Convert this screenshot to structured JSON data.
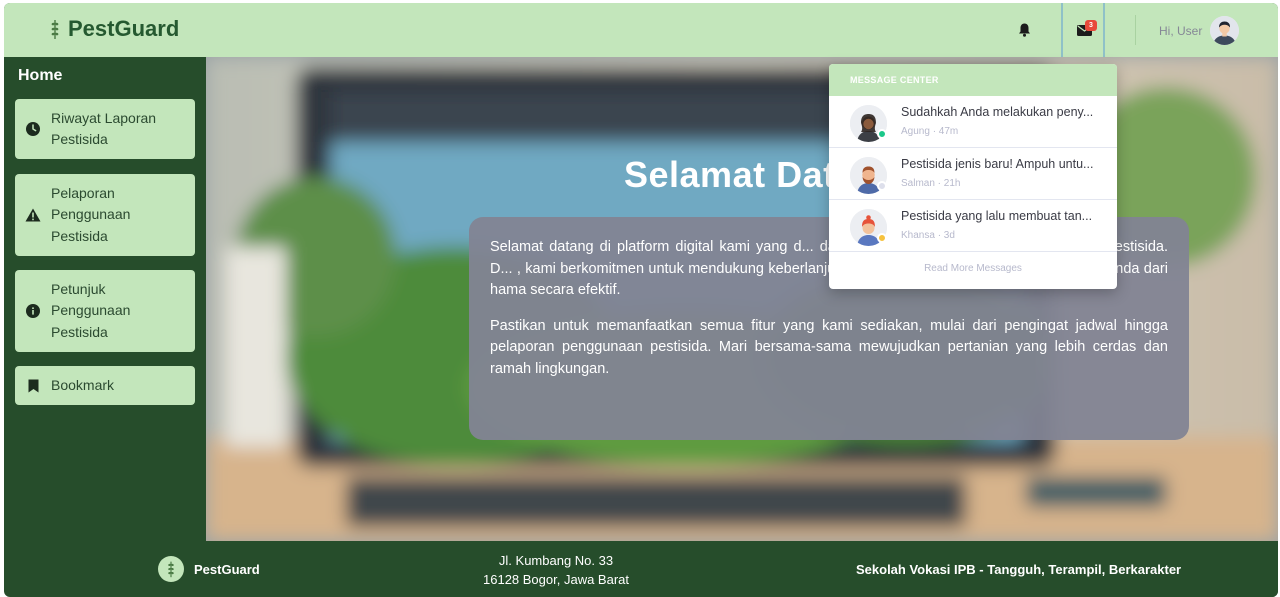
{
  "header": {
    "brand": "PestGuard",
    "greeting": "Hi, User",
    "mail_badge_count": "3",
    "icons": [
      "wheat-icon",
      "bell-icon",
      "envelope-icon",
      "user-avatar"
    ]
  },
  "sidebar": {
    "home_label": "Home",
    "items": [
      {
        "label": "Riwayat Laporan Pestisida",
        "icon": "clock-icon"
      },
      {
        "label": "Pelaporan Penggunaan Pestisida",
        "icon": "warning-icon"
      },
      {
        "label": "Petunjuk Penggunaan Pestisida",
        "icon": "info-icon"
      },
      {
        "label": "Bookmark",
        "icon": "bookmark-icon"
      }
    ]
  },
  "main": {
    "title": "Selamat Dat",
    "paragraphs": [
      "Selamat datang di platform digital kami yang d... dalam meningkatkan efisiensi penggunaan pestisida. D... , kami berkomitmen untuk mendukung keberlanjutan pertanian dan melindungi hasil panen Anda dari hama secara efektif.",
      "Pastikan untuk memanfaatkan semua fitur yang kami sediakan, mulai dari pengingat jadwal hingga pelaporan penggunaan pestisida. Mari bersama-sama mewujudkan pertanian yang lebih cerdas dan ramah lingkungan."
    ]
  },
  "message_center": {
    "header": "MESSAGE CENTER",
    "messages": [
      {
        "text": "Sudahkah Anda melakukan peny...",
        "meta": "Agung · 47m",
        "status_color": "#1cc88a"
      },
      {
        "text": "Pestisida jenis baru! Ampuh untu...",
        "meta": "Salman · 21h",
        "status_color": "#dddfeb"
      },
      {
        "text": "Pestisida yang lalu membuat tan...",
        "meta": "Khansa · 3d",
        "status_color": "#f6c23e"
      }
    ],
    "footer_link": "Read More Messages"
  },
  "footer": {
    "brand": "PestGuard",
    "address_line1": "Jl. Kumbang No. 33",
    "address_line2": "16128 Bogor, Jawa Barat",
    "tagline": "Sekolah Vokasi IPB - Tangguh, Terampil, Berkarakter"
  },
  "colors": {
    "primary_dark": "#264d2b",
    "primary_light": "#c3e6bb",
    "card": "#828494"
  }
}
